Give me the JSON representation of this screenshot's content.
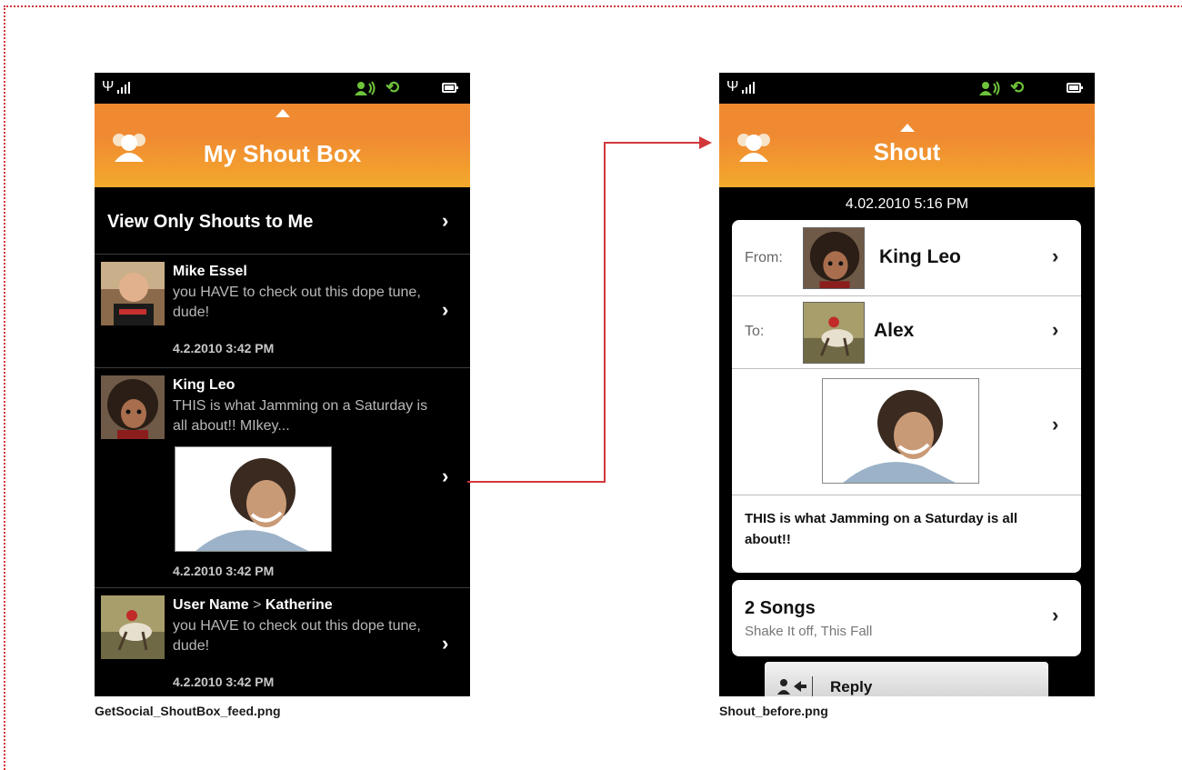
{
  "screens": [
    {
      "header_title": "My Shout Box",
      "caption": "GetSocial_ShoutBox_feed.png",
      "filter_row": {
        "label": "View Only Shouts to Me"
      },
      "items": [
        {
          "name": "Mike Essel",
          "message": "you HAVE to check out this dope tune, dude!",
          "time": "4.2.2010 3:42 PM"
        },
        {
          "name": "King Leo",
          "message": "THIS is what Jamming on a Saturday is all about!! MIkey...",
          "time": "4.2.2010 3:42 PM"
        },
        {
          "name": "User Name",
          "separator": ">",
          "recipient": "Katherine",
          "message": "you HAVE to check out this dope tune, dude!",
          "time": "4.2.2010 3:42 PM"
        }
      ]
    },
    {
      "header_title": "Shout",
      "caption": "Shout_before.png",
      "date": "4.02.2010 5:16 PM",
      "from_label": "From:",
      "from_name": "King Leo",
      "to_label": "To:",
      "to_name": "Alex",
      "message": "THIS is what Jamming on a Saturday is all about!!",
      "songs_title": "2 Songs",
      "songs_subtitle": "Shake It off, This Fall",
      "reply_label": "Reply"
    }
  ],
  "colors": {
    "header_top": "#ef8a31",
    "header_bottom": "#f3a92c",
    "status_green": "#6ec33a",
    "connector_red": "#d2373a"
  },
  "icons": [
    "signal-icon",
    "social-status-icon",
    "sync-icon",
    "battery-icon",
    "people-icon",
    "chevron-right-icon",
    "reply-icon"
  ]
}
